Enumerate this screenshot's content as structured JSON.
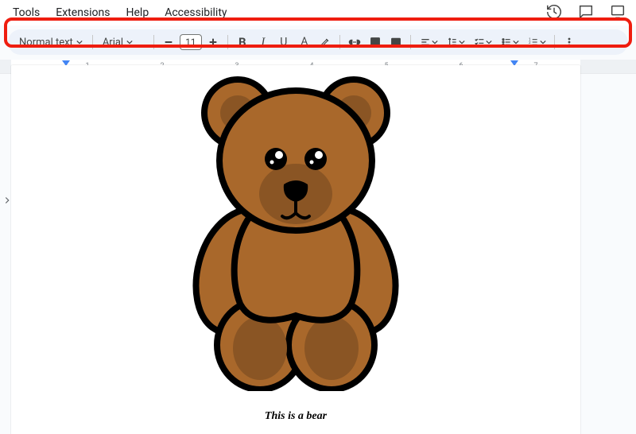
{
  "menubar": {
    "tools": "Tools",
    "extensions": "Extensions",
    "help": "Help",
    "accessibility": "Accessibility"
  },
  "toolbar": {
    "style_label": "Normal text",
    "font_label": "Arial",
    "font_size": "11"
  },
  "ruler": {
    "n1": "1",
    "n2": "2",
    "n3": "3",
    "n4": "4",
    "n5": "5",
    "n6": "6",
    "n7": "7"
  },
  "document": {
    "caption": "This is a bear"
  }
}
